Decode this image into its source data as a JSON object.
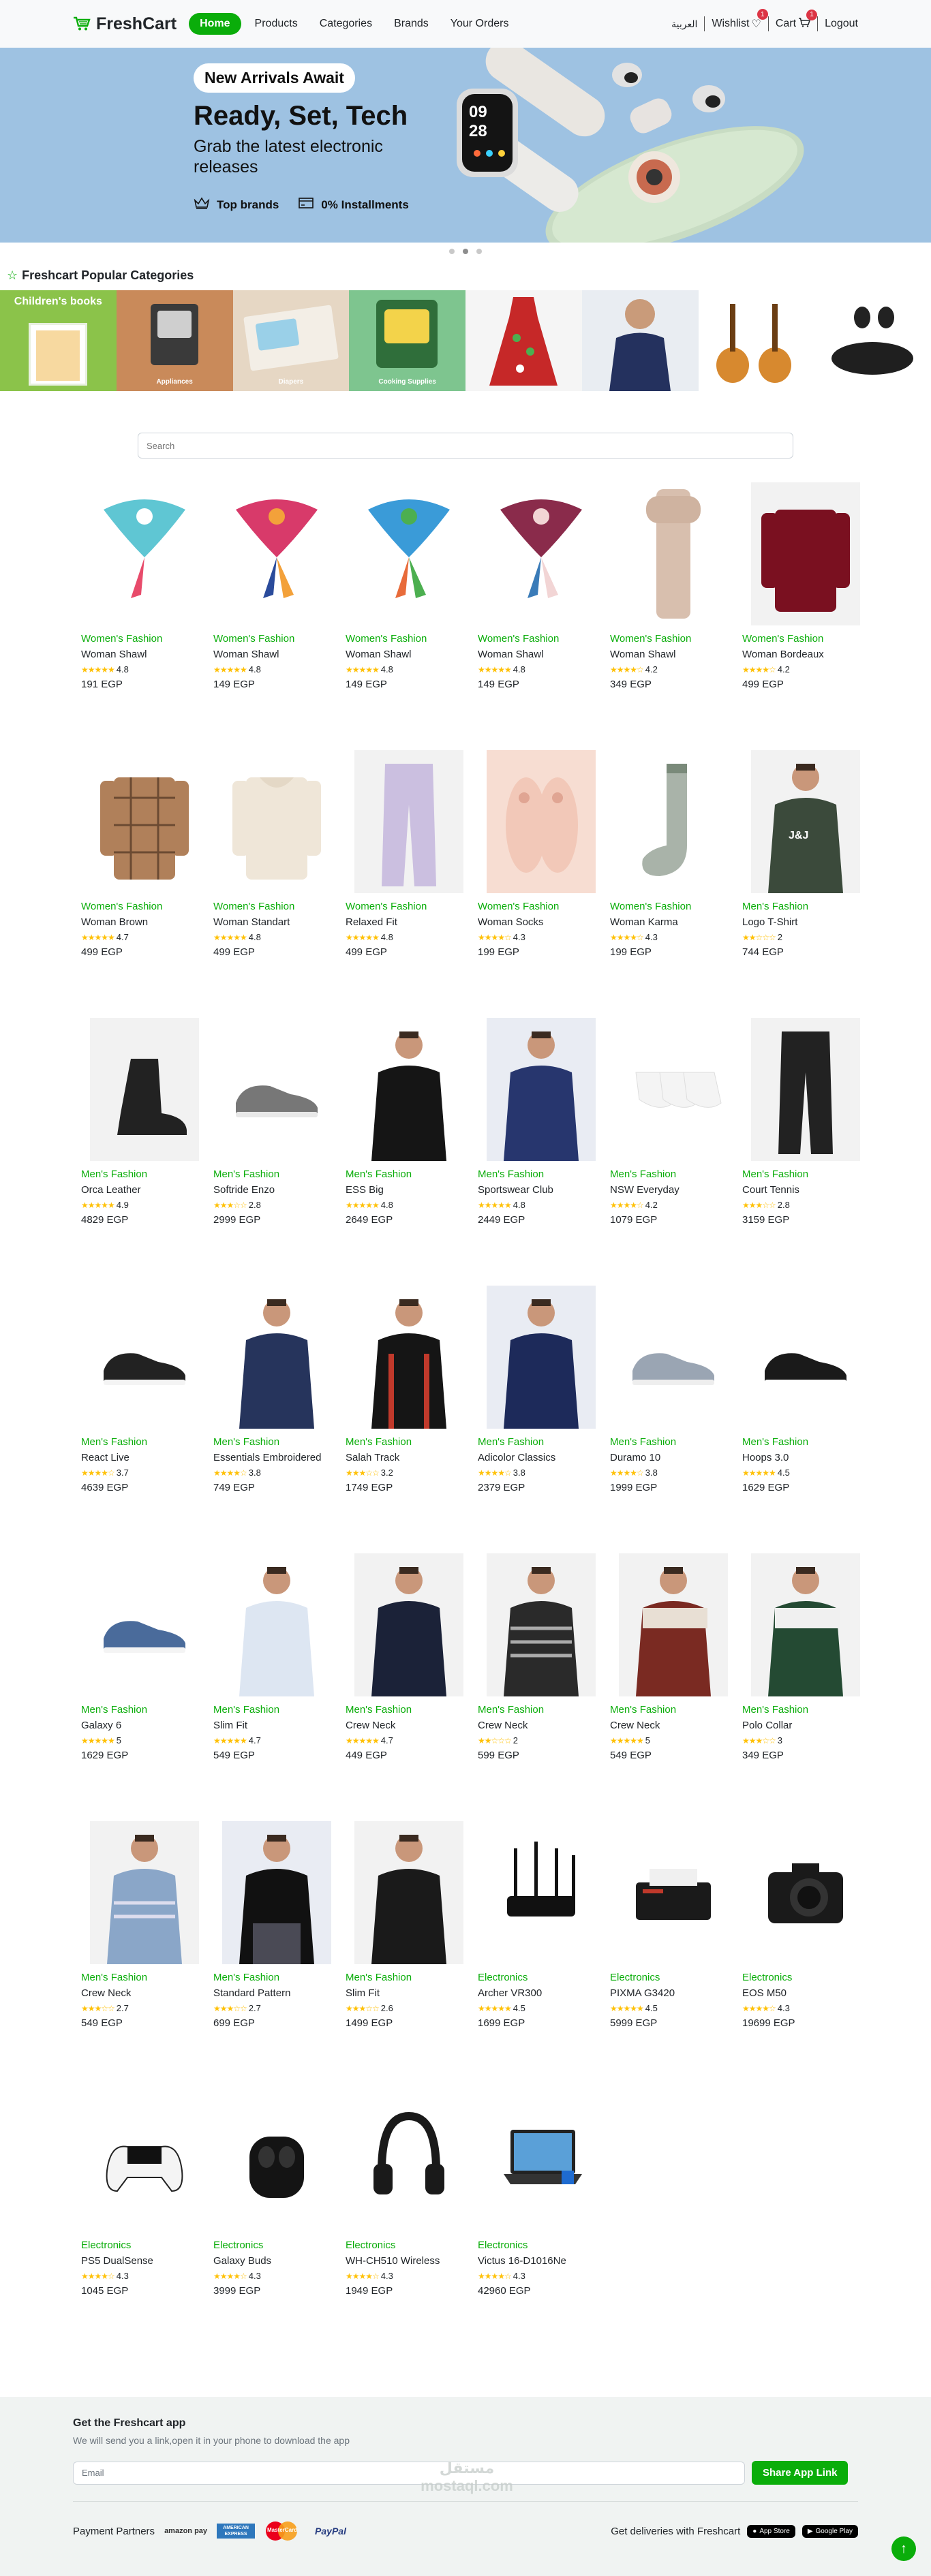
{
  "nav": {
    "brand": "FreshCart",
    "links": [
      "Home",
      "Products",
      "Categories",
      "Brands",
      "Your Orders"
    ],
    "lang": "العربية",
    "wishlist": "Wishlist",
    "wishlist_count": "1",
    "cart": "Cart",
    "cart_count": "1",
    "logout": "Logout"
  },
  "hero": {
    "pill": "New Arrivals Await",
    "title": "Ready, Set, Tech",
    "subtitle": "Grab the latest electronic releases",
    "feature_1": "Top brands",
    "feature_2": "0% Installments",
    "watch_time": "09",
    "watch_time2": "28"
  },
  "categories": {
    "title": "Freshcart Popular Categories",
    "items": [
      "Children's books",
      "Appliances",
      "Diapers",
      "Cooking Supplies",
      "",
      "",
      "",
      ""
    ]
  },
  "search": {
    "placeholder": "Search"
  },
  "products": [
    {
      "cat": "Women's Fashion",
      "name": "Woman Shawl",
      "rating": "4.8",
      "price": "191 EGP",
      "stars": 5
    },
    {
      "cat": "Women's Fashion",
      "name": "Woman Shawl",
      "rating": "4.8",
      "price": "149 EGP",
      "stars": 5
    },
    {
      "cat": "Women's Fashion",
      "name": "Woman Shawl",
      "rating": "4.8",
      "price": "149 EGP",
      "stars": 5
    },
    {
      "cat": "Women's Fashion",
      "name": "Woman Shawl",
      "rating": "4.8",
      "price": "149 EGP",
      "stars": 5
    },
    {
      "cat": "Women's Fashion",
      "name": "Woman Shawl",
      "rating": "4.2",
      "price": "349 EGP",
      "stars": 4
    },
    {
      "cat": "Women's Fashion",
      "name": "Woman Bordeaux",
      "rating": "4.2",
      "price": "499 EGP",
      "stars": 4
    },
    {
      "cat": "Women's Fashion",
      "name": "Woman Brown",
      "rating": "4.7",
      "price": "499 EGP",
      "stars": 5
    },
    {
      "cat": "Women's Fashion",
      "name": "Woman Standart",
      "rating": "4.8",
      "price": "499 EGP",
      "stars": 5
    },
    {
      "cat": "Women's Fashion",
      "name": "Relaxed Fit",
      "rating": "4.8",
      "price": "499 EGP",
      "stars": 5
    },
    {
      "cat": "Women's Fashion",
      "name": "Woman Socks",
      "rating": "4.3",
      "price": "199 EGP",
      "stars": 4
    },
    {
      "cat": "Women's Fashion",
      "name": "Woman Karma",
      "rating": "4.3",
      "price": "199 EGP",
      "stars": 4
    },
    {
      "cat": "Men's Fashion",
      "name": "Logo T-Shirt",
      "rating": "2",
      "price": "744 EGP",
      "stars": 2
    },
    {
      "cat": "Men's Fashion",
      "name": "Orca Leather",
      "rating": "4.9",
      "price": "4829 EGP",
      "stars": 5
    },
    {
      "cat": "Men's Fashion",
      "name": "Softride Enzo",
      "rating": "2.8",
      "price": "2999 EGP",
      "stars": 3
    },
    {
      "cat": "Men's Fashion",
      "name": "ESS Big",
      "rating": "4.8",
      "price": "2649 EGP",
      "stars": 5
    },
    {
      "cat": "Men's Fashion",
      "name": "Sportswear Club",
      "rating": "4.8",
      "price": "2449 EGP",
      "stars": 5
    },
    {
      "cat": "Men's Fashion",
      "name": "NSW Everyday",
      "rating": "4.2",
      "price": "1079 EGP",
      "stars": 4
    },
    {
      "cat": "Men's Fashion",
      "name": "Court Tennis",
      "rating": "2.8",
      "price": "3159 EGP",
      "stars": 3
    },
    {
      "cat": "Men's Fashion",
      "name": "React Live",
      "rating": "3.7",
      "price": "4639 EGP",
      "stars": 4
    },
    {
      "cat": "Men's Fashion",
      "name": "Essentials Embroidered",
      "rating": "3.8",
      "price": "749 EGP",
      "stars": 4
    },
    {
      "cat": "Men's Fashion",
      "name": "Salah Track",
      "rating": "3.2",
      "price": "1749 EGP",
      "stars": 3
    },
    {
      "cat": "Men's Fashion",
      "name": "Adicolor Classics",
      "rating": "3.8",
      "price": "2379 EGP",
      "stars": 4
    },
    {
      "cat": "Men's Fashion",
      "name": "Duramo 10",
      "rating": "3.8",
      "price": "1999 EGP",
      "stars": 4
    },
    {
      "cat": "Men's Fashion",
      "name": "Hoops 3.0",
      "rating": "4.5",
      "price": "1629 EGP",
      "stars": 5
    },
    {
      "cat": "Men's Fashion",
      "name": "Galaxy 6",
      "rating": "5",
      "price": "1629 EGP",
      "stars": 5
    },
    {
      "cat": "Men's Fashion",
      "name": "Slim Fit",
      "rating": "4.7",
      "price": "549 EGP",
      "stars": 5
    },
    {
      "cat": "Men's Fashion",
      "name": "Crew Neck",
      "rating": "4.7",
      "price": "449 EGP",
      "stars": 5
    },
    {
      "cat": "Men's Fashion",
      "name": "Crew Neck",
      "rating": "2",
      "price": "599 EGP",
      "stars": 2
    },
    {
      "cat": "Men's Fashion",
      "name": "Crew Neck",
      "rating": "5",
      "price": "549 EGP",
      "stars": 5
    },
    {
      "cat": "Men's Fashion",
      "name": "Polo Collar",
      "rating": "3",
      "price": "349 EGP",
      "stars": 3
    },
    {
      "cat": "Men's Fashion",
      "name": "Crew Neck",
      "rating": "2.7",
      "price": "549 EGP",
      "stars": 3
    },
    {
      "cat": "Men's Fashion",
      "name": "Standard Pattern",
      "rating": "2.7",
      "price": "699 EGP",
      "stars": 3
    },
    {
      "cat": "Men's Fashion",
      "name": "Slim Fit",
      "rating": "2.6",
      "price": "1499 EGP",
      "stars": 3
    },
    {
      "cat": "Electronics",
      "name": "Archer VR300",
      "rating": "4.5",
      "price": "1699 EGP",
      "stars": 5
    },
    {
      "cat": "Electronics",
      "name": "PIXMA G3420",
      "rating": "4.5",
      "price": "5999 EGP",
      "stars": 5
    },
    {
      "cat": "Electronics",
      "name": "EOS M50",
      "rating": "4.3",
      "price": "19699 EGP",
      "stars": 4
    },
    {
      "cat": "Electronics",
      "name": "PS5 DualSense",
      "rating": "4.3",
      "price": "1045 EGP",
      "stars": 4
    },
    {
      "cat": "Electronics",
      "name": "Galaxy Buds",
      "rating": "4.3",
      "price": "3999 EGP",
      "stars": 4
    },
    {
      "cat": "Electronics",
      "name": "WH-CH510 Wireless",
      "rating": "4.3",
      "price": "1949 EGP",
      "stars": 4
    },
    {
      "cat": "Electronics",
      "name": "Victus 16-D1016Ne",
      "rating": "4.3",
      "price": "42960 EGP",
      "stars": 4
    }
  ],
  "footer": {
    "title": "Get the Freshcart app",
    "subtitle": "We will send you a link,open it in your phone to download the app",
    "email_placeholder": "Email",
    "share_button": "Share App Link",
    "payment_label": "Payment Partners",
    "payment_partners": [
      "amazon pay",
      "AMERICAN EXPRESS",
      "MasterCard",
      "PayPal"
    ],
    "deliveries_label": "Get deliveries with Freshcart",
    "app_store": "App Store",
    "google_play": "Google Play",
    "watermark": "مستقل mostaql.com"
  },
  "colors": {
    "accent": "#0aad0a",
    "badge": "#dc3545",
    "hero_bg": "#9ec2e2",
    "footer_bg": "#f0f3f2"
  }
}
